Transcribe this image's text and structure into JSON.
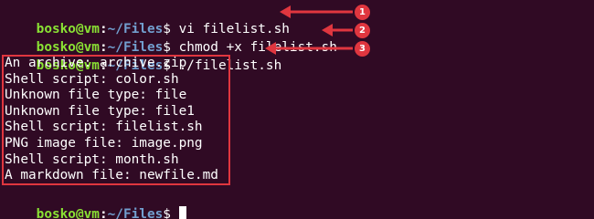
{
  "prompt": {
    "user": "bosko@vm",
    "colon": ":",
    "path": "~/Files",
    "dollar": "$"
  },
  "commands": [
    {
      "text": " vi filelist.sh",
      "step": "1"
    },
    {
      "text": " chmod +x filelist.sh",
      "step": "2"
    },
    {
      "text": " ./filelist.sh",
      "step": "3"
    }
  ],
  "output": [
    "An archive: archive.zip",
    "Shell script: color.sh",
    "Unknown file type: file",
    "Unknown file type: file1",
    "Shell script: filelist.sh",
    "PNG image file: image.png",
    "Shell script: month.sh",
    "A markdown file: newfile.md"
  ],
  "colors": {
    "background": "#300a24",
    "user": "#8ae234",
    "path": "#729fcf",
    "highlight": "#e0363f"
  }
}
